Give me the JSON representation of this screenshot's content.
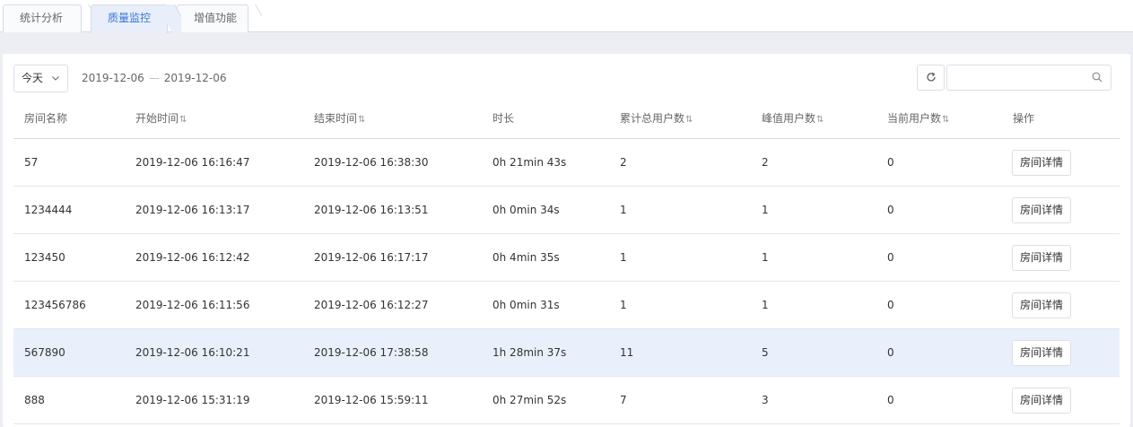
{
  "tabs": [
    {
      "label": "统计分析",
      "active": false
    },
    {
      "label": "质量监控",
      "active": true
    },
    {
      "label": "增值功能",
      "active": false
    }
  ],
  "toolbar": {
    "period": "今天",
    "date_start": "2019-12-06",
    "date_sep": "—",
    "date_end": "2019-12-06",
    "search_value": "",
    "search_placeholder": ""
  },
  "table": {
    "headers": [
      {
        "label": "房间名称",
        "sortable": false
      },
      {
        "label": "开始时间",
        "sortable": true
      },
      {
        "label": "结束时间",
        "sortable": true
      },
      {
        "label": "时长",
        "sortable": false
      },
      {
        "label": "累计总用户数",
        "sortable": true
      },
      {
        "label": "峰值用户数",
        "sortable": true
      },
      {
        "label": "当前用户数",
        "sortable": true
      },
      {
        "label": "操作",
        "sortable": false
      }
    ],
    "sort_glyph": "⇅",
    "action_label": "房间详情",
    "rows": [
      {
        "room": "57",
        "start": "2019-12-06 16:16:47",
        "end": "2019-12-06 16:38:30",
        "duration": "0h 21min 43s",
        "total": "2",
        "peak": "2",
        "current": "0",
        "highlight": false
      },
      {
        "room": "1234444",
        "start": "2019-12-06 16:13:17",
        "end": "2019-12-06 16:13:51",
        "duration": "0h 0min 34s",
        "total": "1",
        "peak": "1",
        "current": "0",
        "highlight": false
      },
      {
        "room": "123450",
        "start": "2019-12-06 16:12:42",
        "end": "2019-12-06 16:17:17",
        "duration": "0h 4min 35s",
        "total": "1",
        "peak": "1",
        "current": "0",
        "highlight": false
      },
      {
        "room": "123456786",
        "start": "2019-12-06 16:11:56",
        "end": "2019-12-06 16:12:27",
        "duration": "0h 0min 31s",
        "total": "1",
        "peak": "1",
        "current": "0",
        "highlight": false
      },
      {
        "room": "567890",
        "start": "2019-12-06 16:10:21",
        "end": "2019-12-06 17:38:58",
        "duration": "1h 28min 37s",
        "total": "11",
        "peak": "5",
        "current": "0",
        "highlight": true
      },
      {
        "room": "888",
        "start": "2019-12-06 15:31:19",
        "end": "2019-12-06 15:59:11",
        "duration": "0h 27min 52s",
        "total": "7",
        "peak": "3",
        "current": "0",
        "highlight": false
      }
    ]
  },
  "colors": {
    "accent": "#3a76d8",
    "row_highlight": "#e9f0fb",
    "page_bg": "#eceef4"
  }
}
